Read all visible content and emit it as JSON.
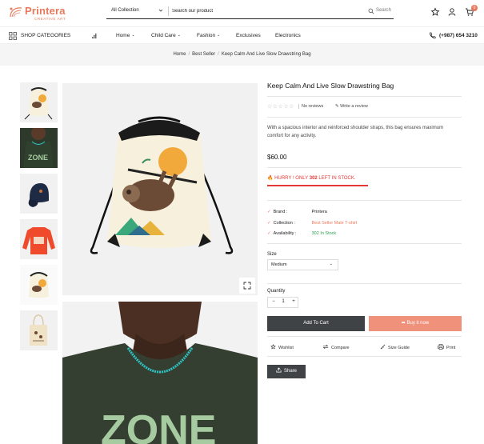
{
  "brand": {
    "name": "Printera",
    "tagline": "CREATIVE ART"
  },
  "header": {
    "collection_label": "All Collection",
    "search_placeholder": "Search our product",
    "search_button": "Search",
    "cart_count": "0"
  },
  "nav": {
    "shop_categories": "SHOP CATEGORIES",
    "items": [
      {
        "label": "Home",
        "has_dropdown": true
      },
      {
        "label": "Child Care",
        "has_dropdown": true
      },
      {
        "label": "Fashion",
        "has_dropdown": true
      },
      {
        "label": "Exclusives",
        "has_dropdown": false
      },
      {
        "label": "Electronics",
        "has_dropdown": false
      }
    ],
    "phone": "(+987) 654 3210"
  },
  "breadcrumb": [
    "Home",
    "Best Seller",
    "Keep Calm And Live Slow Drawstring Bag"
  ],
  "gallery": {
    "thumbnails": [
      "sloth-drawstring-bag",
      "green-zone-tshirt",
      "navy-cap",
      "red-long-sleeve-tee",
      "sloth-bag-small",
      "canvas-tote-bag"
    ]
  },
  "product": {
    "title": "Keep Calm And Live Slow Drawstring Bag",
    "rating": 0,
    "reviews_text": "No reviews",
    "write_review": "Write a review",
    "description": "With a spacious interior and reinforced shoulder straps, this bag ensures maximum comfort for any activity.",
    "price": "$60.00",
    "hurry_prefix": "HURRY ! ONLY",
    "stock_count": "302",
    "hurry_suffix": "LEFT IN STOCK.",
    "brand_label": "Brand :",
    "brand_value": "Printera",
    "collection_label": "Collection :",
    "collection_value": "Best Seller Male T-shirt",
    "availability_label": "Availability :",
    "availability_value": "302 In Stock",
    "size_label": "Size",
    "size_value": "Medium",
    "quantity_label": "Quantity",
    "quantity_value": "1",
    "add_to_cart": "Add To Cart",
    "buy_now": "Buy it now",
    "wishlist": "Wishlist",
    "compare": "Compare",
    "size_guide": "Size Guide",
    "print": "Print",
    "share": "Share"
  },
  "colors": {
    "accent": "#e8795c",
    "hurry_red": "#e53935",
    "dark_button": "#3f4346",
    "buy_button": "#f0917c",
    "availability_green": "#2e9e4f",
    "collection_link": "#e8795c"
  }
}
